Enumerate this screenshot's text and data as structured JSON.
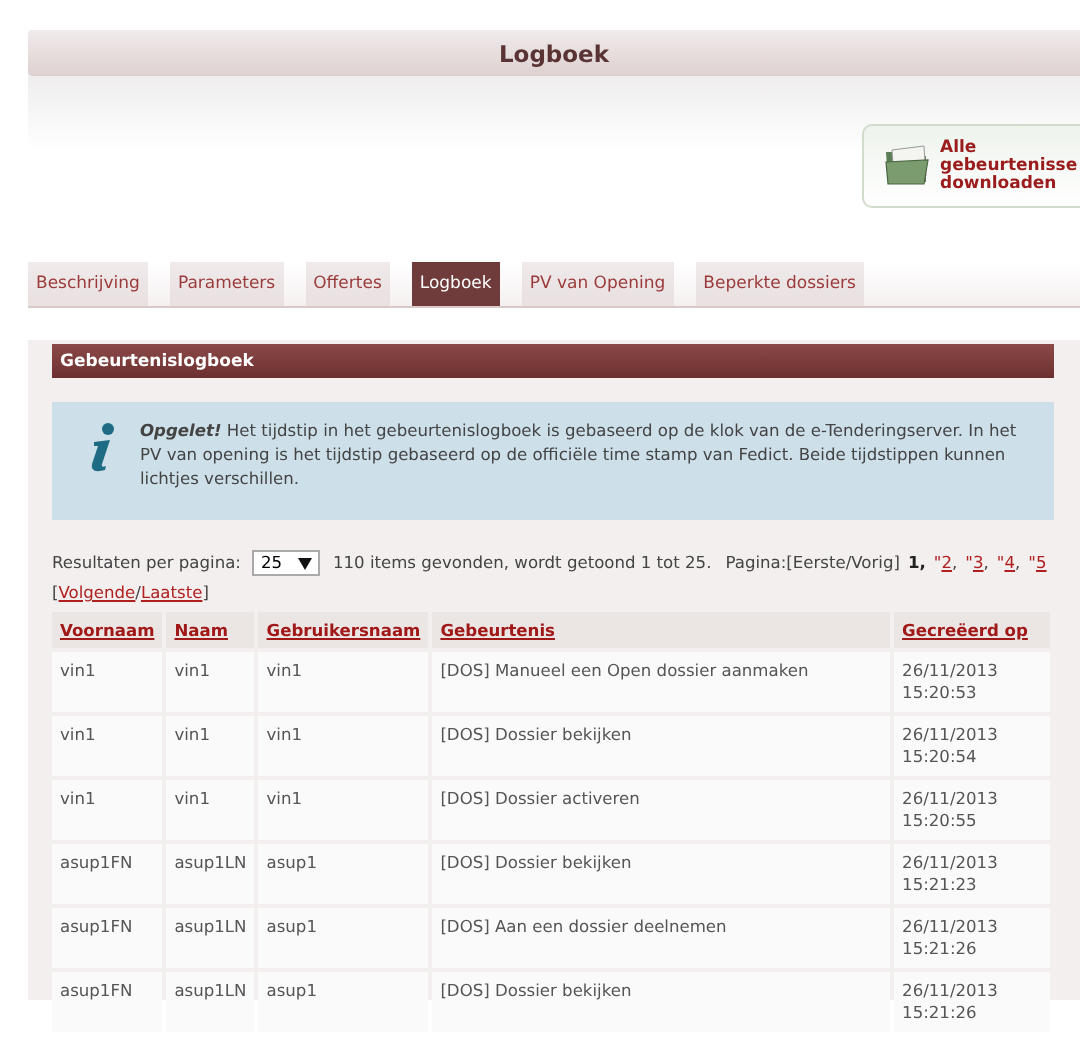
{
  "page_title": "Logboek",
  "download_button": {
    "lines": [
      "Alle",
      "gebeurtenisse",
      "downloaden"
    ]
  },
  "tabs": [
    {
      "label": "Beschrijving",
      "selected": false
    },
    {
      "label": "Parameters",
      "selected": false
    },
    {
      "label": "Offertes",
      "selected": false
    },
    {
      "label": "Logboek",
      "selected": true
    },
    {
      "label": "PV van Opening",
      "selected": false
    },
    {
      "label": "Beperkte dossiers",
      "selected": false
    }
  ],
  "section_title": "Gebeurtenislogboek",
  "notice": "**Opgelet!** Het tijdstip in het gebeurtenislogboek is gebaseerd op de klok van de e-Tenderingserver. In het PV van opening is het tijdstip gebaseerd op de officiële time stamp van Fedict. Beide tijdstippen kunnen lichtjes verschillen.",
  "pagination": {
    "per_page_label": "Resultaten per pagina:",
    "per_page_value": "25",
    "summary": "110 items gevonden, wordt getoond 1 tot 25.",
    "page_label": "Pagina:[Eerste/Vorig]",
    "pages": [
      {
        "label": "1",
        "separator": ",",
        "selected": true
      },
      {
        "prefix": "\"",
        "label": "2",
        "separator": ",",
        "selected": false
      },
      {
        "prefix": "\"",
        "label": "3",
        "separator": ",",
        "selected": false
      },
      {
        "prefix": "\"",
        "label": "4",
        "separator": ",",
        "selected": false
      },
      {
        "prefix": "\"",
        "label": "5",
        "selected": false
      }
    ],
    "next_open": "[",
    "next_links": [
      "Volgende",
      "Laatste"
    ],
    "next_separator": "/",
    "next_close": "]"
  },
  "table": {
    "columns": [
      "Voornaam",
      "Naam",
      "Gebruikersnaam",
      "Gebeurtenis",
      "Gecreëerd op"
    ],
    "rows": [
      [
        "vin1",
        "vin1",
        "vin1",
        "[DOS] Manueel een Open dossier aanmaken",
        "26/11/2013 15:20:53"
      ],
      [
        "vin1",
        "vin1",
        "vin1",
        "[DOS] Dossier bekijken",
        "26/11/2013 15:20:54"
      ],
      [
        "vin1",
        "vin1",
        "vin1",
        "[DOS] Dossier activeren",
        "26/11/2013 15:20:55"
      ],
      [
        "asup1FN",
        "asup1LN",
        "asup1",
        "[DOS] Dossier bekijken",
        "26/11/2013 15:21:23"
      ],
      [
        "asup1FN",
        "asup1LN",
        "asup1",
        "[DOS] Aan een dossier deelnemen",
        "26/11/2013 15:21:26"
      ],
      [
        "asup1FN",
        "asup1LN",
        "asup1",
        "[DOS] Dossier bekijken",
        "26/11/2013 15:21:26"
      ]
    ]
  }
}
